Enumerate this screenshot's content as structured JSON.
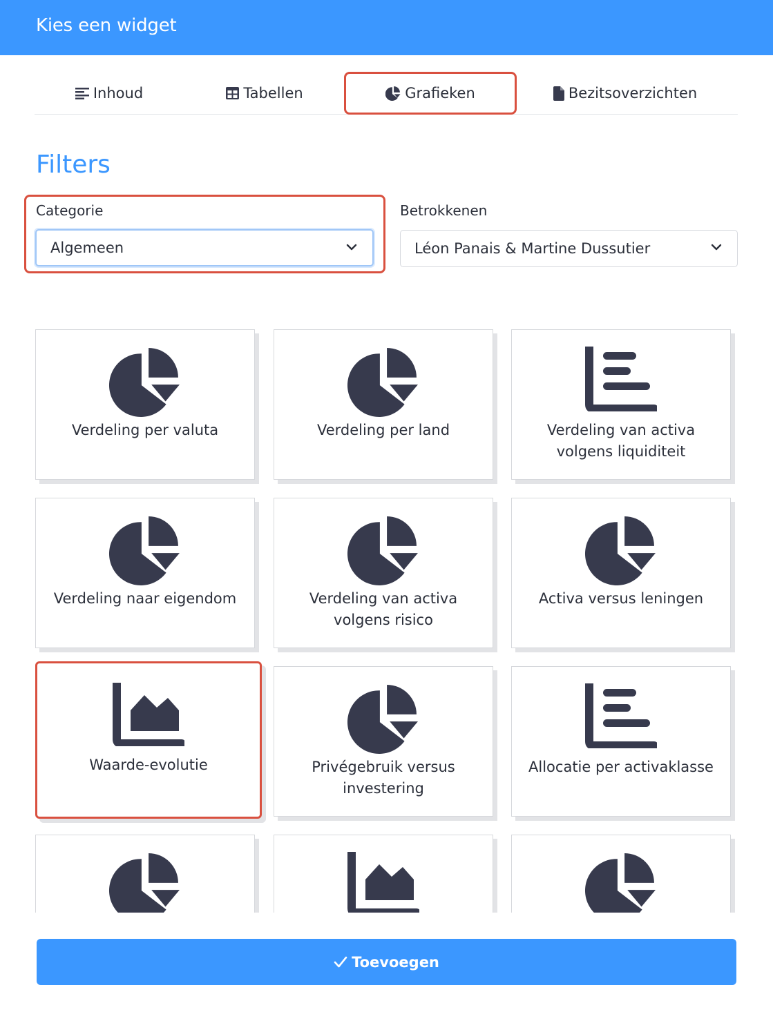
{
  "header": {
    "title": "Kies een widget"
  },
  "tabs": [
    {
      "label": "Inhoud",
      "icon": "align-left-icon"
    },
    {
      "label": "Tabellen",
      "icon": "table-icon"
    },
    {
      "label": "Grafieken",
      "icon": "pie-chart-icon",
      "active": true
    },
    {
      "label": "Bezitsoverzichten",
      "icon": "file-icon"
    }
  ],
  "filters": {
    "title": "Filters",
    "categorie": {
      "label": "Categorie",
      "value": "Algemeen"
    },
    "betrokkenen": {
      "label": "Betrokkenen",
      "value": "Léon Panais & Martine Dussutier"
    }
  },
  "widgets": [
    {
      "label": "Verdeling per valuta",
      "icon": "pie-chart-icon"
    },
    {
      "label": "Verdeling per land",
      "icon": "pie-chart-icon"
    },
    {
      "label": "Verdeling van activa volgens liquiditeit",
      "icon": "bar-chart-icon"
    },
    {
      "label": "Verdeling naar eigendom",
      "icon": "pie-chart-icon"
    },
    {
      "label": "Verdeling van activa volgens risico",
      "icon": "pie-chart-icon"
    },
    {
      "label": "Activa versus leningen",
      "icon": "pie-chart-icon"
    },
    {
      "label": "Waarde-evolutie",
      "icon": "area-chart-icon",
      "selected": true
    },
    {
      "label": "Privégebruik versus investering",
      "icon": "pie-chart-icon"
    },
    {
      "label": "Allocatie per activaklasse",
      "icon": "bar-chart-icon"
    },
    {
      "label": "",
      "icon": "pie-chart-icon"
    },
    {
      "label": "",
      "icon": "area-chart-icon"
    },
    {
      "label": "",
      "icon": "pie-chart-icon"
    }
  ],
  "footer": {
    "submit_label": "Toevoegen",
    "icon": "check-icon"
  },
  "colors": {
    "primary": "#3b97ff",
    "highlight": "#d9503f",
    "icon": "#373a4d"
  }
}
